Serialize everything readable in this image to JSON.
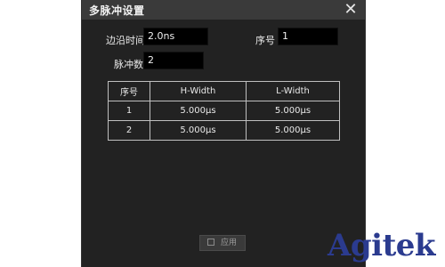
{
  "dialog": {
    "title": "多脉冲设置",
    "close_icon": "close-icon",
    "edge_time_label": "边沿时间",
    "edge_time_value": "2.0ns",
    "seq_label": "序号",
    "seq_value": "1",
    "pulse_count_label": "脉冲数",
    "pulse_count_value": "2",
    "table": {
      "headers": [
        "序号",
        "H-Width",
        "L-Width"
      ],
      "rows": [
        [
          "1",
          "5.000μs",
          "5.000μs"
        ],
        [
          "2",
          "5.000μs",
          "5.000μs"
        ]
      ]
    },
    "apply_label": "应用",
    "apply_icon": "apply-icon"
  },
  "watermark": {
    "text": "Agitek",
    "color": "#2b3b8f"
  },
  "colors": {
    "dialog_bg": "#222222",
    "titlebar_bg": "#3a3a3a",
    "field_bg": "#000000",
    "grid_border": "#bfbfbf"
  }
}
